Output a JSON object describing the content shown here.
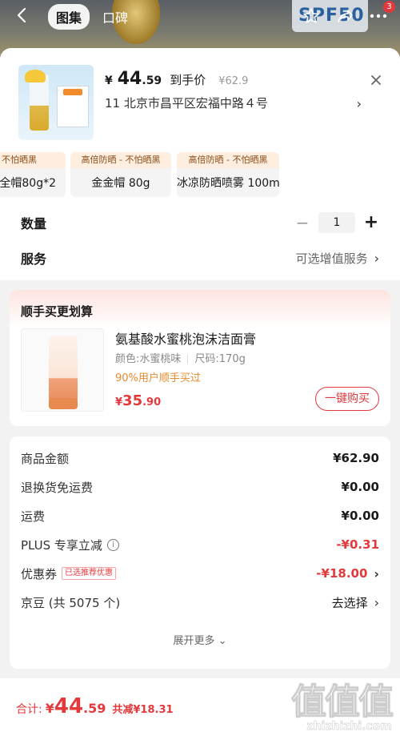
{
  "header": {
    "tabs": [
      {
        "label": "图集"
      },
      {
        "label": "口碑"
      }
    ],
    "spf_text": "SPF50",
    "cart_badge": "3"
  },
  "product": {
    "currency": "¥",
    "price_int": "44",
    "price_dec": ".59",
    "price_tag": "到手价",
    "orig_price": "¥62.9",
    "address": "11  北京市昌平区宏福中路４号"
  },
  "skus": [
    {
      "tag": "i - 不怕晒黑",
      "name": "全帽80g*2"
    },
    {
      "tag": "高倍防晒 - 不怕晒黑",
      "name": "金金帽 80g"
    },
    {
      "tag": "高倍防晒 - 不怕晒黑",
      "name": "冰凉防晒喷雾 100ml"
    }
  ],
  "quantity": {
    "label": "数量",
    "value": "1"
  },
  "service": {
    "label": "服务",
    "value": "可选增值服务"
  },
  "recommend": {
    "heading": "顺手买更划算",
    "title": "氨基酸水蜜桃泡沫洁面膏",
    "color": "颜色:水蜜桃味",
    "size": "尺码:170g",
    "percent": "90%用户顺手买过",
    "price_sym": "¥",
    "price_int": "35",
    "price_dec": ".90",
    "button": "一键购买"
  },
  "summary": {
    "rows": [
      {
        "k": "商品金额",
        "v": "¥62.90"
      },
      {
        "k": "退换货免运费",
        "v": "¥0.00"
      },
      {
        "k": "运费",
        "v": "¥0.00"
      },
      {
        "k": "PLUS 专享立减",
        "v": "-¥0.31"
      },
      {
        "k": "优惠券",
        "tag": "已选推荐优惠",
        "v": "-¥18.00"
      },
      {
        "k": "京豆 (共 5075 个)",
        "v": "去选择"
      }
    ],
    "more": "展开更多"
  },
  "footer": {
    "label": "合计:",
    "sym": "¥",
    "int": "44",
    "dec": ".59",
    "save": "共减¥18.31"
  },
  "watermark": {
    "big": "值值值",
    "small": "zhizhizhi.com"
  }
}
